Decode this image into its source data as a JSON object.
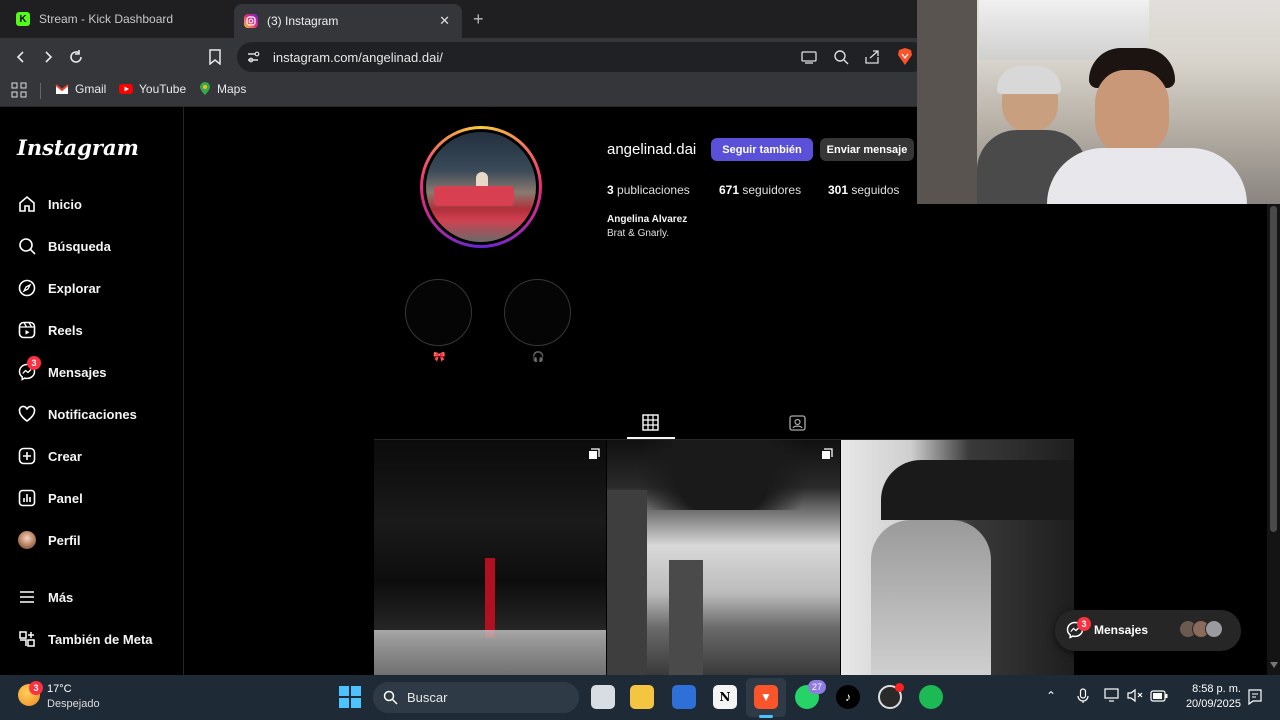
{
  "browser": {
    "tabs": [
      {
        "label": "Stream - Kick Dashboard"
      },
      {
        "label": "(3) Instagram"
      }
    ],
    "new_tab": "+",
    "close": "✕",
    "url": "instagram.com/angelinad.dai/",
    "bookmarks": [
      {
        "label": "Gmail"
      },
      {
        "label": "YouTube"
      },
      {
        "label": "Maps"
      }
    ]
  },
  "sidebar": {
    "logo": "Instagram",
    "items": [
      {
        "label": "Inicio",
        "icon": "home-icon"
      },
      {
        "label": "Búsqueda",
        "icon": "search-icon"
      },
      {
        "label": "Explorar",
        "icon": "compass-icon"
      },
      {
        "label": "Reels",
        "icon": "reels-icon"
      },
      {
        "label": "Mensajes",
        "icon": "messenger-icon",
        "badge": "3"
      },
      {
        "label": "Notificaciones",
        "icon": "heart-icon"
      },
      {
        "label": "Crear",
        "icon": "plus-icon"
      },
      {
        "label": "Panel",
        "icon": "chart-icon"
      },
      {
        "label": "Perfil",
        "icon": "avatar-icon"
      },
      {
        "label": "Más",
        "icon": "menu-icon"
      },
      {
        "label": "También de Meta",
        "icon": "meta-icon"
      }
    ]
  },
  "profile": {
    "username": "angelinad.dai",
    "follow_label": "Seguir también",
    "message_label": "Enviar mensaje",
    "posts_count": "3",
    "posts_label": "publicaciones",
    "followers_count": "671",
    "followers_label": "seguidores",
    "following_count": "301",
    "following_label": "seguidos",
    "full_name": "Angelina Alvarez",
    "bio": "Brat & Gnarly.",
    "highlights": [
      {
        "label": "🎀"
      },
      {
        "label": "🎧"
      }
    ]
  },
  "messages_popup": {
    "label": "Mensajes",
    "badge": "3"
  },
  "taskbar": {
    "weather_temp": "17°C",
    "weather_desc": "Despejado",
    "weather_badge": "3",
    "search_label": "Buscar",
    "whatsapp_badge": "27",
    "time": "8:58 p. m.",
    "date": "20/09/2025"
  },
  "colors": {
    "accent": "#5b51d8",
    "badge": "#ff3040",
    "kick_green": "#53fc18",
    "instagram_pink": "#e1306c"
  }
}
